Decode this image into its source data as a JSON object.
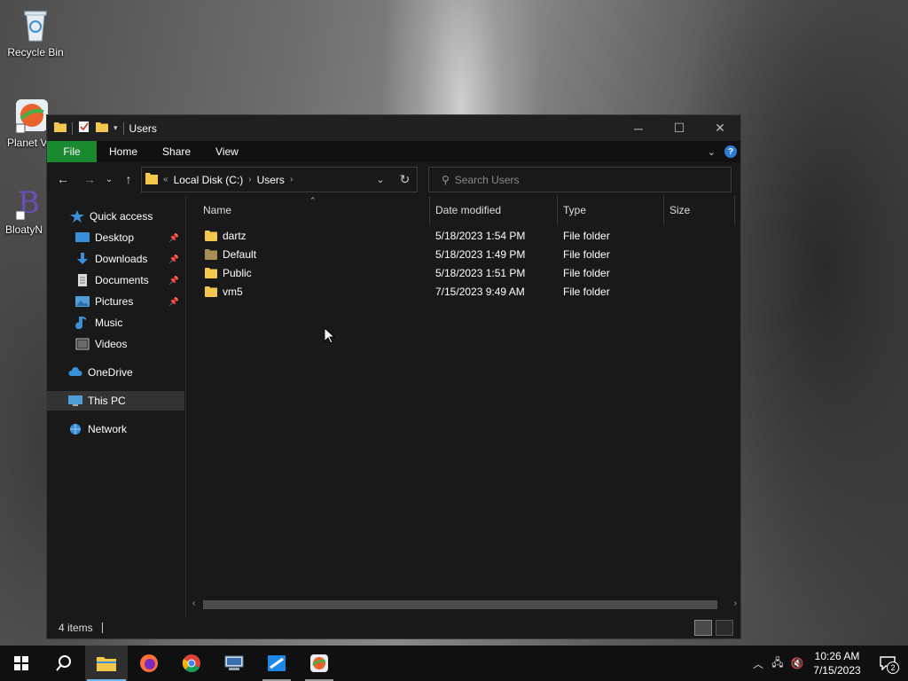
{
  "desktop": {
    "icons": [
      {
        "label": "Recycle Bin"
      },
      {
        "label": "Planet V"
      },
      {
        "label": "BloatyN"
      }
    ]
  },
  "window": {
    "title": "Users",
    "ribbon_tabs": [
      "File",
      "Home",
      "Share",
      "View"
    ],
    "help_label": "?",
    "address": {
      "overflow": "«",
      "crumbs": [
        "Local Disk (C:)",
        "Users"
      ]
    },
    "search": {
      "placeholder": "Search Users"
    },
    "nav_pane": {
      "quick_access": "Quick access",
      "pinned": [
        "Desktop",
        "Downloads",
        "Documents",
        "Pictures"
      ],
      "unpinned": [
        "Music",
        "Videos"
      ],
      "onedrive": "OneDrive",
      "this_pc": "This PC",
      "network": "Network"
    },
    "columns": {
      "name": "Name",
      "date": "Date modified",
      "type": "Type",
      "size": "Size"
    },
    "files": [
      {
        "name": "dartz",
        "date": "5/18/2023 1:54 PM",
        "type": "File folder"
      },
      {
        "name": "Default",
        "date": "5/18/2023 1:49 PM",
        "type": "File folder"
      },
      {
        "name": "Public",
        "date": "5/18/2023 1:51 PM",
        "type": "File folder"
      },
      {
        "name": "vm5",
        "date": "7/15/2023 9:49 AM",
        "type": "File folder"
      }
    ],
    "status": {
      "count": "4 items"
    }
  },
  "taskbar": {
    "apps": [
      "start-icon",
      "search-icon",
      "file-explorer-icon",
      "firefox-icon",
      "chrome-icon",
      "network-app-icon",
      "remote-app-icon",
      "planet-vpn-icon"
    ],
    "clock": {
      "time": "10:26 AM",
      "date": "7/15/2023"
    },
    "notification_count": "2"
  },
  "colors": {
    "window_bg": "#191919",
    "file_tab": "#1a8a30",
    "folder": "#f2c94c",
    "accent": "#76b9ed"
  }
}
